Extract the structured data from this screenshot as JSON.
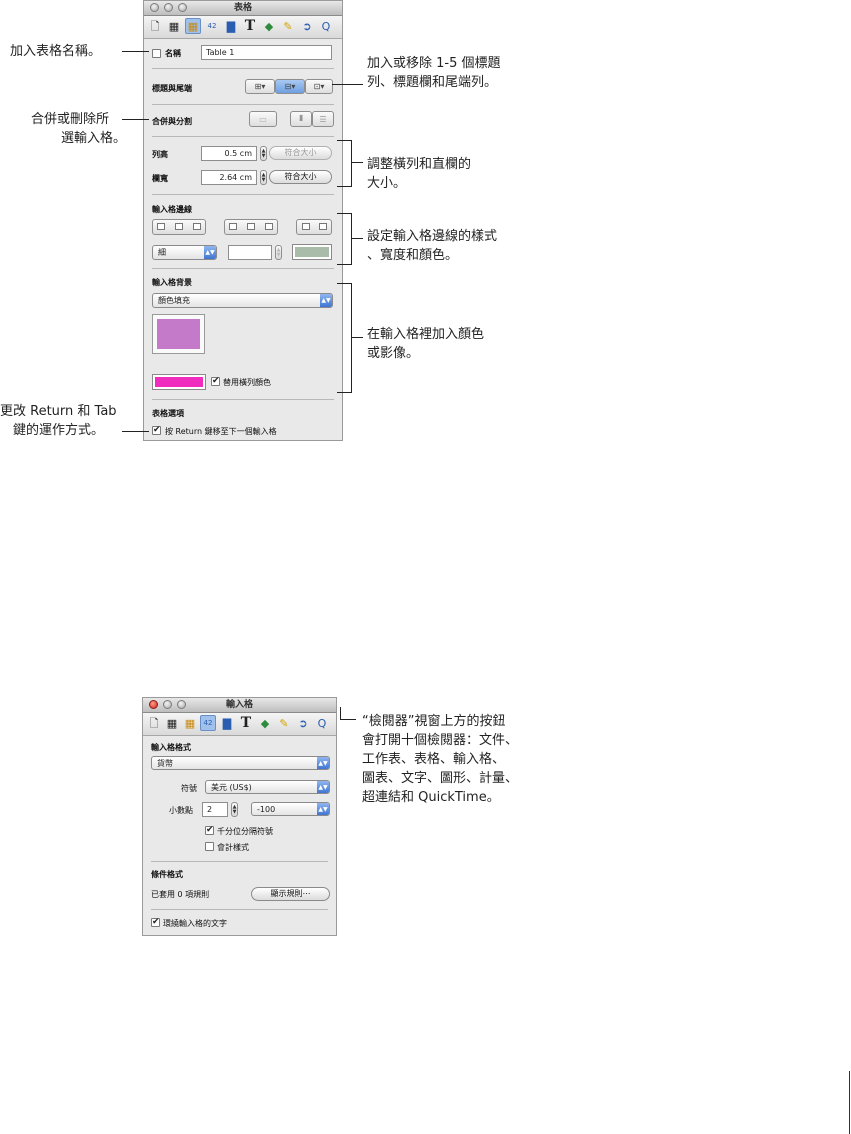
{
  "table_inspector": {
    "title": "表格",
    "name_label": "名稱",
    "name_value": "Table 1",
    "headers_footers_label": "標題與尾端",
    "merge_split_label": "合併與分割",
    "row_height_label": "列高",
    "row_height_value": "0.5 cm",
    "col_width_label": "欄寬",
    "col_width_value": "2.64 cm",
    "fit_button": "符合大小",
    "cell_borders_label": "輸入格邊線",
    "border_style_value": "細",
    "cell_background_label": "輸入格背景",
    "background_fill_value": "顏色填充",
    "fill_color": "#c57ac9",
    "alternate_color": "#f02cbf",
    "alternate_rows_label": "替用橫列顏色",
    "table_options_label": "表格選項",
    "return_key_label": "按 Return 鍵移至下一個輸入格"
  },
  "cell_inspector": {
    "title": "輸入格",
    "cell_format_label": "輸入格格式",
    "format_value": "貨幣",
    "symbol_label": "符號",
    "symbol_value": "美元 (US$)",
    "decimals_label": "小數點",
    "decimals_value": "2",
    "negative_value": "-100",
    "thousands_label": "千分位分隔符號",
    "accounting_label": "會計樣式",
    "conditional_label": "條件格式",
    "rules_applied": "已套用 0 項規則",
    "show_rules_button": "顯示規則⋯",
    "wrap_text_label": "環繞輸入格的文字"
  },
  "callouts": {
    "add_name": "加入表格名稱。",
    "headers_1": "加入或移除 1-5 個標題",
    "headers_2": "列、標題欄和尾端列。",
    "merge_1": "合併或刪除所",
    "merge_2": "選輸入格。",
    "size_1": "調整橫列和直欄的",
    "size_2": "大小。",
    "borders_1": "設定輸入格邊線的樣式",
    "borders_2": "、寬度和顏色。",
    "background_1": "在輸入格裡加入顏色",
    "background_2": "或影像。",
    "return_1": "更改 Return 和 Tab",
    "return_2": "鍵的運作方式。",
    "inspector_1": "“檢閱器”視窗上方的按鈕",
    "inspector_2": "會打開十個檢閱器：文件、",
    "inspector_3": "工作表、表格、輸入格、",
    "inspector_4": "圖表、文字、圖形、計量、",
    "inspector_5": "超連結和 QuickTime。"
  }
}
